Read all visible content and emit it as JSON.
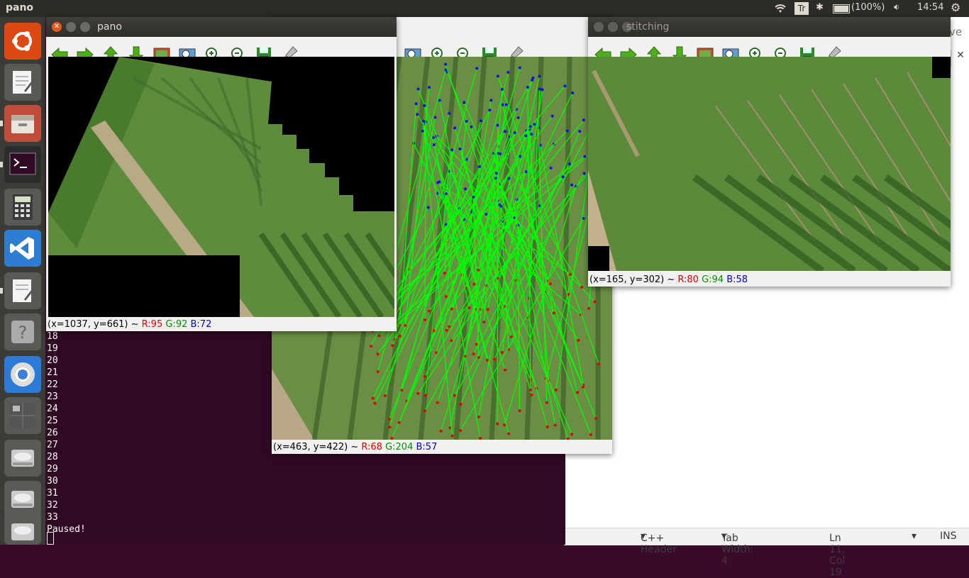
{
  "top_panel": {
    "title": "pano",
    "keyboard_indicator": "Tr",
    "battery": "(100%)",
    "time": "14:54"
  },
  "terminal": {
    "lines": [
      "18",
      "19",
      "20",
      "21",
      "22",
      "23",
      "24",
      "25",
      "26",
      "27",
      "28",
      "29",
      "30",
      "31",
      "32",
      "33"
    ],
    "status": "Paused!"
  },
  "gedit_status": {
    "language": "C++ Header",
    "tab_width": "Tab Width: 4",
    "position": "Ln 11, Col 19",
    "mode": "INS"
  },
  "windows": {
    "pano": {
      "title": "pano",
      "status_prefix": "(x=1037, y=661) ~",
      "r": "R:95",
      "g": "G:92",
      "b": "B:72"
    },
    "matches": {
      "status_prefix": "(x=463, y=422) ~",
      "r": "R:68",
      "g": "G:204",
      "b": "B:57"
    },
    "stitching": {
      "title": "stitching",
      "status_prefix": "(x=165, y=302) ~",
      "r": "R:80",
      "g": "G:94",
      "b": "B:58"
    }
  },
  "background_window_fragment": "ve",
  "colors": {
    "terminal_bg": "#300a24",
    "match_line": "#00ff00",
    "keypoint_red": "#e00000",
    "keypoint_blue": "#1010e0",
    "toolbar_arrow": "#4caf1a"
  }
}
